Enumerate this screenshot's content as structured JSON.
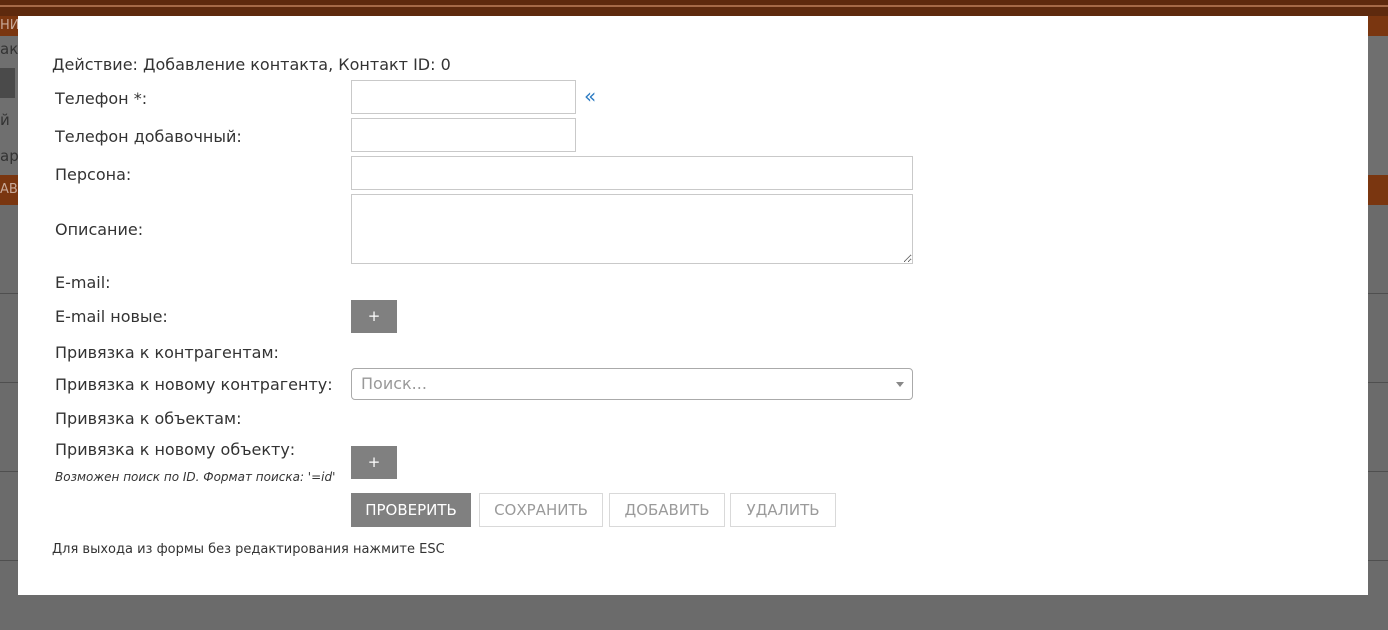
{
  "background": {
    "top_stripe_text": "НИ",
    "left_texts": [
      "ак",
      "й",
      "ар"
    ],
    "orange_bar_text": "АВ"
  },
  "modal": {
    "action_text": "Действие: Добавление контакта, Контакт ID: 0",
    "fields": {
      "phone_label": "Телефон *:",
      "phone_value": "",
      "phone_ext_label": "Телефон добавочный:",
      "phone_ext_value": "",
      "person_label": "Персона:",
      "person_value": "",
      "description_label": "Описание:",
      "description_value": "",
      "email_label": "E-mail:",
      "email_new_label": "E-mail новые:",
      "contractors_label": "Привязка к контрагентам:",
      "new_contractor_label": "Привязка к новому контрагенту:",
      "new_contractor_placeholder": "Поиск...",
      "objects_label": "Привязка к объектам:",
      "new_object_label": "Привязка к новому объекту:",
      "object_hint": "Возможен поиск по ID. Формат поиска: '=id'"
    },
    "icons": {
      "phone_chevron": "«",
      "plus": "+"
    },
    "buttons": {
      "check": "ПРОВЕРИТЬ",
      "save": "СОХРАНИТЬ",
      "add": "ДОБАВИТЬ",
      "delete": "УДАЛИТЬ"
    },
    "esc_note": "Для выхода из формы без редактирования нажмите ESC"
  },
  "colors": {
    "overlay": "#6f6f6f",
    "brand_dark": "#5e2a0e",
    "brand_orange": "#7a3610",
    "primary_button": "#808080",
    "link_blue": "#2e7cc3"
  }
}
